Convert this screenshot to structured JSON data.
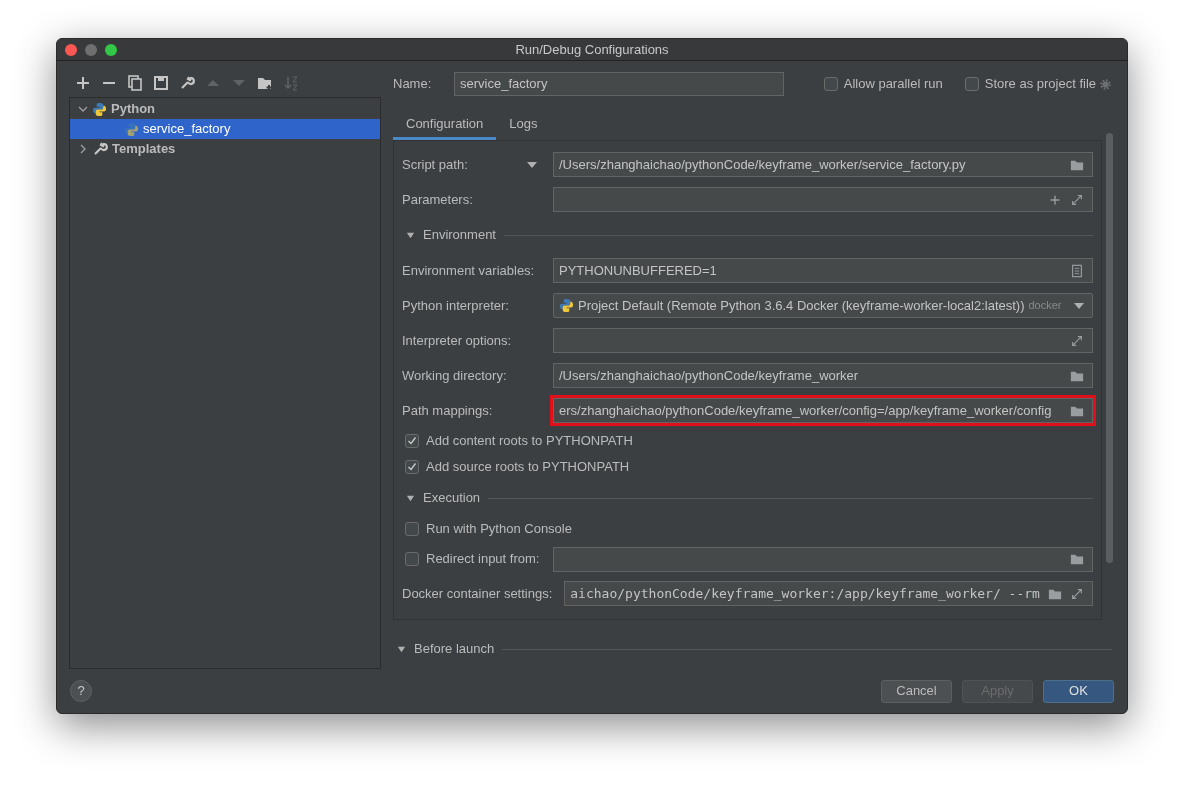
{
  "window": {
    "title": "Run/Debug Configurations"
  },
  "toolbar": [
    {
      "kind": "add",
      "disabled": false
    },
    {
      "kind": "remove",
      "disabled": false
    },
    {
      "kind": "copy",
      "disabled": false
    },
    {
      "kind": "save",
      "disabled": false
    },
    {
      "kind": "wrench",
      "disabled": false
    },
    {
      "kind": "up",
      "disabled": true
    },
    {
      "kind": "down",
      "disabled": true
    },
    {
      "kind": "folder",
      "disabled": false
    },
    {
      "kind": "sort",
      "disabled": true
    }
  ],
  "tree": [
    {
      "label": "Python",
      "kind": "python",
      "expanded": true,
      "selected": false,
      "children": [
        {
          "label": "service_factory",
          "kind": "python",
          "selected": true
        }
      ]
    },
    {
      "label": "Templates",
      "kind": "wrench",
      "expanded": false,
      "selected": false
    }
  ],
  "name_field": {
    "label": "Name:",
    "value": "service_factory"
  },
  "options": [
    {
      "label": "Allow parallel run",
      "checked": false
    },
    {
      "label": "Store as project file",
      "checked": false
    }
  ],
  "tabs": [
    {
      "label": "Configuration",
      "selected": true
    },
    {
      "label": "Logs",
      "selected": false
    }
  ],
  "form": [
    {
      "kind": "field",
      "label": "Script path:",
      "label_dropdown": true,
      "value": "/Users/zhanghaichao/pythonCode/keyframe_worker/service_factory.py",
      "icons": [
        {
          "kind": "folder"
        }
      ]
    },
    {
      "kind": "field",
      "label": "Parameters:",
      "icons": [
        {
          "kind": "plus"
        },
        {
          "kind": "expand"
        }
      ]
    },
    {
      "kind": "section",
      "label": "Environment",
      "expanded": true
    },
    {
      "kind": "field",
      "label": "Environment variables:",
      "value": "PYTHONUNBUFFERED=1",
      "icons": [
        {
          "kind": "list"
        }
      ]
    },
    {
      "kind": "select",
      "label": "Python interpreter:",
      "value": "Project Default (Remote Python 3.6.4 Docker (keyframe-worker-local2:latest))",
      "hint": "docker"
    },
    {
      "kind": "field",
      "label": "Interpreter options:",
      "icons": [
        {
          "kind": "expand"
        }
      ]
    },
    {
      "kind": "field",
      "label": "Working directory:",
      "value": "/Users/zhanghaichao/pythonCode/keyframe_worker",
      "icons": [
        {
          "kind": "folder"
        }
      ]
    },
    {
      "kind": "field",
      "label": "Path mappings:",
      "value": "ers/zhanghaichao/pythonCode/keyframe_worker/config=/app/keyframe_worker/config",
      "icons": [
        {
          "kind": "folder"
        }
      ],
      "highlighted": true
    },
    {
      "kind": "checkbox",
      "label": "Add content roots to PYTHONPATH",
      "checked": true
    },
    {
      "kind": "checkbox",
      "label": "Add source roots to PYTHONPATH",
      "checked": true
    },
    {
      "kind": "section",
      "label": "Execution",
      "expanded": true
    },
    {
      "kind": "checkbox",
      "label": "Run with Python Console",
      "checked": false
    },
    {
      "kind": "checkbox_field",
      "label": "Redirect input from:",
      "checked": false,
      "icons": [
        {
          "kind": "folder"
        }
      ]
    },
    {
      "kind": "field",
      "label": "Docker container settings:",
      "value": "aichao/pythonCode/keyframe_worker:/app/keyframe_worker/ --rm",
      "icons": [
        {
          "kind": "folder"
        },
        {
          "kind": "expand"
        }
      ],
      "monospace": true
    }
  ],
  "before_launch": {
    "label": "Before launch",
    "expanded": true
  },
  "help": "?",
  "buttons": [
    {
      "label": "Cancel",
      "kind": "default",
      "disabled": false
    },
    {
      "label": "Apply",
      "kind": "default",
      "disabled": true
    },
    {
      "label": "OK",
      "kind": "primary",
      "disabled": false
    }
  ]
}
